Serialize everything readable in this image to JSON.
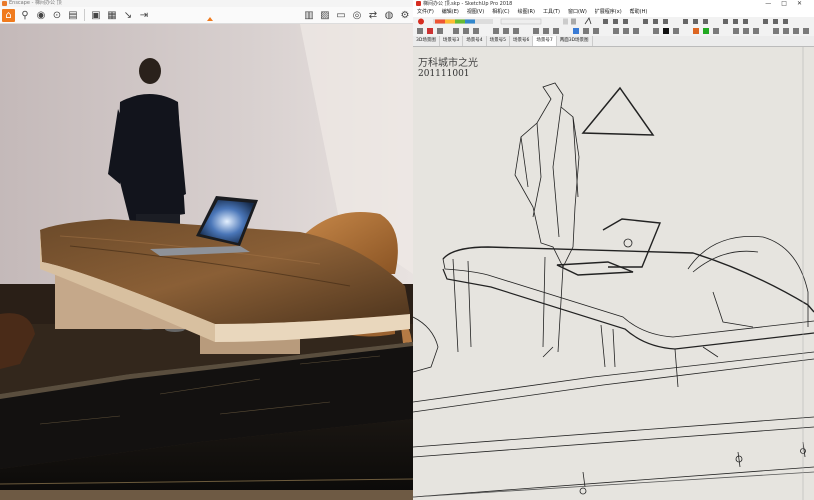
{
  "enscape": {
    "window_title": "Enscape - 梯间办公 顶",
    "toolbar_icons": [
      "home-icon",
      "asset-library-icon",
      "camera-icon",
      "panorama-icon",
      "video-icon",
      "screenshot-icon",
      "layers-icon",
      "arrow-icon",
      "export-icon",
      "settings-icon",
      "visual-settings-icon",
      "sync-icon"
    ]
  },
  "sketchup": {
    "window_title": "梯间办公 顶.skp - SketchUp Pro 2018",
    "window_buttons": [
      "—",
      "□",
      "✕"
    ],
    "menus": [
      "文件(F)",
      "编辑(E)",
      "视图(V)",
      "相机(C)",
      "绘图(R)",
      "工具(T)",
      "窗口(W)",
      "扩展程序(x)",
      "帮助(H)"
    ],
    "scene_tabs": [
      "3D场景图",
      "场景号3",
      "场景号4",
      "场景号5",
      "场景号6",
      "场景号7",
      "两面3D场景图"
    ],
    "active_tab_index": 5,
    "viewport_label_name": "万科城市之光",
    "viewport_label_number": "201111001"
  }
}
